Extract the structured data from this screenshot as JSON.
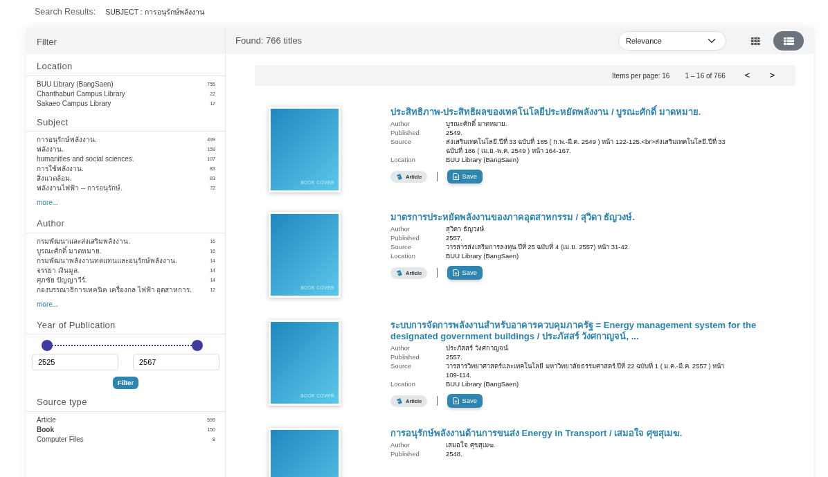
{
  "header": {
    "label": "Search Results:",
    "query": "SUBJECT : การอนุรักษ์พลังงาน"
  },
  "filter": {
    "title": "Filter",
    "facets": [
      {
        "title": "Location",
        "kind": "list",
        "items": [
          {
            "label": "BUU Library (BangSaen)",
            "count": "755"
          },
          {
            "label": "Chanthaburi Campus Library",
            "count": "22"
          },
          {
            "label": "Sakaeo Campus Library",
            "count": "12"
          }
        ]
      },
      {
        "title": "Subject",
        "kind": "list",
        "more": "more...",
        "items": [
          {
            "label": "การอนุรักษ์พลังงาน.",
            "count": "499"
          },
          {
            "label": "พลังงาน.",
            "count": "159"
          },
          {
            "label": "humanities and social sciences.",
            "count": "107"
          },
          {
            "label": "การใช้พลังงาน.",
            "count": "83"
          },
          {
            "label": "สิ่งแวดล้อม.",
            "count": "83"
          },
          {
            "label": "พลังงานไฟฟ้า -- การอนุรักษ์.",
            "count": "72"
          }
        ]
      },
      {
        "title": "Author",
        "kind": "list",
        "more": "more...",
        "items": [
          {
            "label": "กรมพัฒนาและส่งเสริมพลังงาน.",
            "count": "16"
          },
          {
            "label": "บูรณะศักดิ์ มาดหมาย.",
            "count": "16"
          },
          {
            "label": "กรมพัฒนาพลังงานทดแทนและอนุรักษ์พลังงาน.",
            "count": "14"
          },
          {
            "label": "จรรยา เงินมูล.",
            "count": "14"
          },
          {
            "label": "ศุภชัย ปัญญาวีร์.",
            "count": "14"
          },
          {
            "label": "กองบรรณาธิการเทคนิค เครื่องกล ไฟฟ้า อุตสาหการ.",
            "count": "12"
          }
        ]
      },
      {
        "title": "Year of Publication",
        "kind": "range",
        "thumbs": [
          {
            "level": 0
          },
          {
            "level": 1
          }
        ],
        "from": "2525",
        "to": "2567",
        "button": "Filter"
      },
      {
        "title": "Source type",
        "kind": "list",
        "items": [
          {
            "label": "Article",
            "count": "599",
            "bold": false
          },
          {
            "label": "Book",
            "count": "150",
            "bold": true
          },
          {
            "label": "Computer Files",
            "count": "8",
            "bold": false
          }
        ]
      }
    ]
  },
  "results_bar": {
    "found": "Found: 766 titles",
    "sort": "Relevance",
    "views": [
      {
        "kind": "grid",
        "selected": false
      },
      {
        "kind": "list",
        "selected": true
      }
    ]
  },
  "pager": {
    "items_per_page": "Items per page: 16",
    "range": "1 – 16 of 766",
    "prev": "<",
    "next": ">"
  },
  "results": [
    {
      "title": "ประสิทธิภาพ-ประสิทธิผลของเทคโนโลยีประหยัดพลังงาน / บูรณะศักดิ์ มาดหมาย.",
      "cover": "BOOK COVER",
      "fields": [
        {
          "label": "Author",
          "value": "บูรณะศักดิ์ มาดหมาย."
        },
        {
          "label": "Published",
          "value": "2549."
        },
        {
          "label": "Source",
          "value": "ส่งเสริมเทคโนโลยี.ปีที่ 33 ฉบับที่ 185 ( ก.พ.-มี.ค. 2549 ) หน้า 122-125.<br>ส่งเสริมเทคโนโลยี.ปีที่ 33 ฉบับที่ 186 ( เม.ย.-พ.ค. 2549 ) หน้า 164-167."
        },
        {
          "label": "Location",
          "value": "BUU Library (BangSaen)"
        }
      ],
      "type": "Article",
      "save": "Save"
    },
    {
      "title": "มาตรการประหยัดพลังงานของภาคอุตสาหกรรม / สุวิดา ธัญวงษ์.",
      "cover": "BOOK COVER",
      "fields": [
        {
          "label": "Author",
          "value": "สุวิดา ธัญวงษ์."
        },
        {
          "label": "Published",
          "value": "2557."
        },
        {
          "label": "Source",
          "value": "วารสารส่งเสริมการลงทุน.ปีที่ 25 ฉบับที่ 4 (เม.ย. 2557) หน้า 31-42."
        },
        {
          "label": "Location",
          "value": "BUU Library (BangSaen)"
        }
      ],
      "type": "Article",
      "save": "Save"
    },
    {
      "title": "ระบบการจัดการพลังงานสำหรับอาคารควบคุมภาครัฐ = Energy management system for the designated government buildings / ประภัสสร์ วังศกาญจน์, ...",
      "cover": "BOOK COVER",
      "fields": [
        {
          "label": "Author",
          "value": "ประภัสสร์ วังศกาญจน์."
        },
        {
          "label": "Published",
          "value": "2557."
        },
        {
          "label": "Source",
          "value": "วารสารวิทยาศาสตร์และเทคโนโลยี มหาวิทยาลัยธรรมศาสตร์.ปีที่ 22 ฉบับที่ 1 ( ม.ค.-มี.ค. 2557 ) หน้า 109-114."
        },
        {
          "label": "Location",
          "value": "BUU Library (BangSaen)"
        }
      ],
      "type": "Article",
      "save": "Save"
    },
    {
      "title": "การอนุรักษ์พลังงานด้านการขนส่ง Energy in Transport / เสมอใจ ศุขสุเมฆ.",
      "fields": [
        {
          "label": "Author",
          "value": "เสมอใจ ศุขสุเมฆ."
        },
        {
          "label": "Published",
          "value": "2548."
        }
      ]
    }
  ]
}
